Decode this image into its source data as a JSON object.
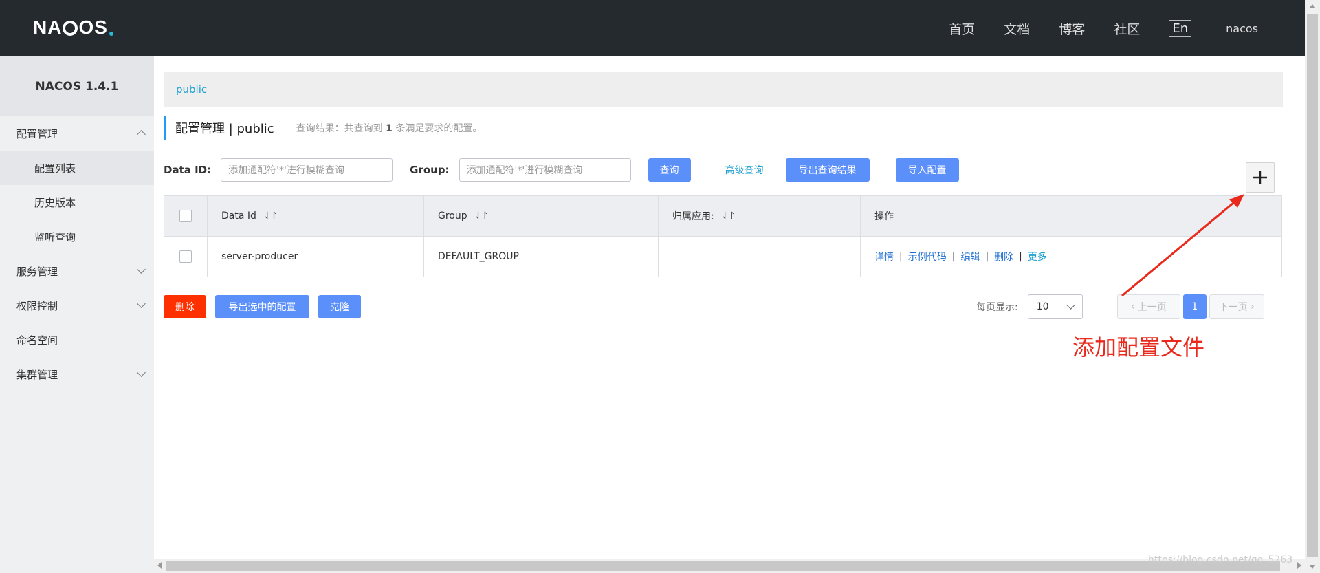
{
  "header": {
    "logo": {
      "prefix": "NA",
      "suffix": "OS",
      "c": "C"
    },
    "nav": [
      "首页",
      "文档",
      "博客",
      "社区"
    ],
    "lang": "En",
    "user": "nacos"
  },
  "sidebar": {
    "title": "NACOS 1.4.1",
    "groups": [
      {
        "label": "配置管理",
        "children": [
          "配置列表",
          "历史版本",
          "监听查询"
        ]
      },
      {
        "label": "服务管理"
      },
      {
        "label": "权限控制"
      },
      {
        "label": "命名空间"
      },
      {
        "label": "集群管理"
      }
    ]
  },
  "main": {
    "breadcrumb": "public",
    "title": "配置管理  |  public",
    "query_prefix": "查询结果：共查询到 ",
    "query_count": "1",
    "query_suffix": " 条满足要求的配置。",
    "search": {
      "data_id_label": "Data ID:",
      "data_id_placeholder": "添加通配符'*'进行模糊查询",
      "group_label": "Group:",
      "group_placeholder": "添加通配符'*'进行模糊查询",
      "query_btn": "查询",
      "advanced_link": "高级查询",
      "export_btn": "导出查询结果",
      "import_btn": "导入配置"
    },
    "table": {
      "headers": [
        "Data Id",
        "Group",
        "归属应用:",
        "操作"
      ],
      "rows": [
        {
          "data_id": "server-producer",
          "group": "DEFAULT_GROUP",
          "app": "",
          "ops": [
            "详情",
            "示例代码",
            "编辑",
            "删除",
            "更多"
          ]
        }
      ],
      "sort_icon": "⇃↾"
    },
    "bottom": {
      "delete_btn": "删除",
      "export_selected_btn": "导出选中的配置",
      "clone_btn": "克隆",
      "page_size_label": "每页显示:",
      "page_size": "10",
      "prev": "上一页",
      "page": "1",
      "next": "下一页"
    },
    "annotation": "添加配置文件"
  },
  "watermark": "https://blog.csdn.net/qq_5263",
  "colors": {
    "header_bg": "#252a2f",
    "primary": "#5b8ff9",
    "danger": "#ff3000",
    "link": "#1e9fd0",
    "annotation": "#e8291c"
  }
}
